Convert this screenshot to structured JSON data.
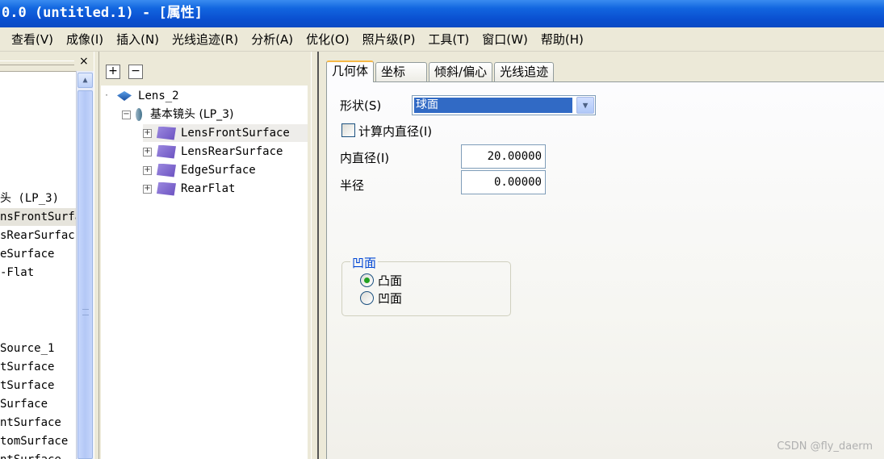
{
  "window": {
    "title": "0.0  (untitled.1) - [属性]"
  },
  "menu": [
    "查看(V)",
    "成像(I)",
    "插入(N)",
    "光线追迹(R)",
    "分析(A)",
    "优化(O)",
    "照片级(P)",
    "工具(T)",
    "窗口(W)",
    "帮助(H)"
  ],
  "left_panel": {
    "close": "×",
    "rows": [
      "头 (LP_3)",
      "nsFrontSurfa",
      "sRearSurfac",
      "eSurface",
      "-Flat",
      "Source_1",
      "tSurface",
      "tSurface",
      "Surface",
      "ntSurface",
      "tomSurface",
      "ntSurface"
    ],
    "scroll_up": "▲"
  },
  "tree": {
    "add": "+",
    "remove": "−",
    "root": "Lens_2",
    "group": "基本镜头 (LP_3)",
    "children": [
      "LensFrontSurface",
      "LensRearSurface",
      "EdgeSurface",
      "RearFlat"
    ],
    "expand_glyph": "+",
    "collapse_glyph": "−"
  },
  "props": {
    "tabs": [
      "几何体",
      "坐标",
      "倾斜/偏心",
      "光线追迹"
    ],
    "shape_label": "形状(S)",
    "shape_value": "球面",
    "dropdown_arrow": "▼",
    "calc_label": "计算内直径(I)",
    "inner_label": "内直径(I)",
    "inner_value": "20.00000",
    "radius_label": "半径",
    "radius_value": "0.00000",
    "group_title": "凹面",
    "options": [
      "凸面",
      "凹面"
    ],
    "selected_option": 0
  },
  "watermark": "CSDN @fly_daerm"
}
